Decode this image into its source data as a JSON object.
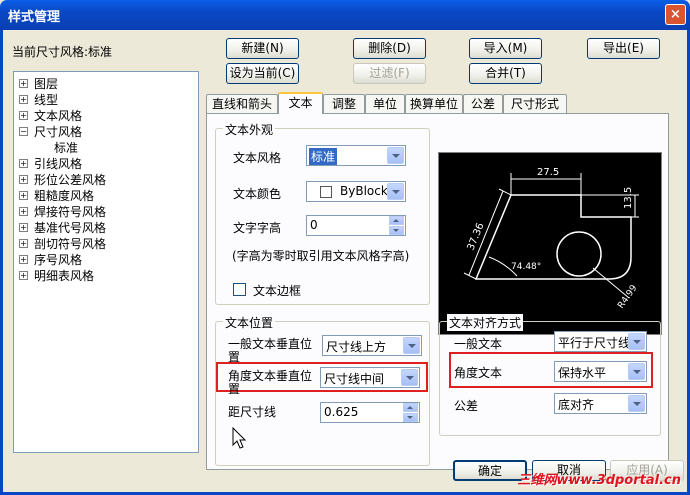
{
  "window": {
    "title": "样式管理",
    "close_label": "×"
  },
  "current_style_label": "当前尺寸风格:标准",
  "buttons": {
    "new": "新建(N)",
    "delete": "删除(D)",
    "import": "导入(M)",
    "export": "导出(E)",
    "set_current": "设为当前(C)",
    "filter": "过滤(F)",
    "merge": "合并(T)",
    "ok": "确定",
    "cancel": "取消",
    "apply": "应用(A)"
  },
  "tree": {
    "items": [
      {
        "label": "图层",
        "state": "+"
      },
      {
        "label": "线型",
        "state": "+"
      },
      {
        "label": "文本风格",
        "state": "+"
      },
      {
        "label": "尺寸风格",
        "state": "−"
      },
      {
        "label": "标准",
        "state": ""
      },
      {
        "label": "引线风格",
        "state": "+"
      },
      {
        "label": "形位公差风格",
        "state": "+"
      },
      {
        "label": "粗糙度风格",
        "state": "+"
      },
      {
        "label": "焊接符号风格",
        "state": "+"
      },
      {
        "label": "基准代号风格",
        "state": "+"
      },
      {
        "label": "剖切符号风格",
        "state": "+"
      },
      {
        "label": "序号风格",
        "state": "+"
      },
      {
        "label": "明细表风格",
        "state": "+"
      }
    ]
  },
  "tabs": [
    "直线和箭头",
    "文本",
    "调整",
    "单位",
    "换算单位",
    "公差",
    "尺寸形式"
  ],
  "text_appearance": {
    "group_title": "文本外观",
    "style_label": "文本风格",
    "style_value": "标准",
    "color_label": "文本颜色",
    "color_value": "ByBlock",
    "height_label": "文字字高",
    "height_value": "0",
    "note": "(字高为零时取引用文本风格字高)",
    "border_label": "文本边框"
  },
  "text_position": {
    "group_title": "文本位置",
    "general_label_1": "一般文本垂直位",
    "general_label_2": "置",
    "general_value": "尺寸线上方",
    "angle_label_1": "角度文本垂直位",
    "angle_label_2": "置",
    "angle_value": "尺寸线中间",
    "offset_label": "距尺寸线",
    "offset_value": "0.625"
  },
  "text_alignment": {
    "group_title": "文本对齐方式",
    "general_label": "一般文本",
    "general_value": "平行于尺寸线",
    "angle_label": "角度文本",
    "angle_value": "保持水平",
    "tolerance_label": "公差",
    "tolerance_value": "底对齐"
  },
  "preview": {
    "dim_top": "27.5",
    "dim_right": "13.5",
    "dim_left": "37.36",
    "dim_angle": "74.48°",
    "dim_radius": "R4.99"
  },
  "watermark": "三维网www.3dportal.cn",
  "colors": {
    "highlight_red": "#e02020",
    "selection_blue": "#316ac5",
    "titlebar_blue": "#0847c4"
  }
}
